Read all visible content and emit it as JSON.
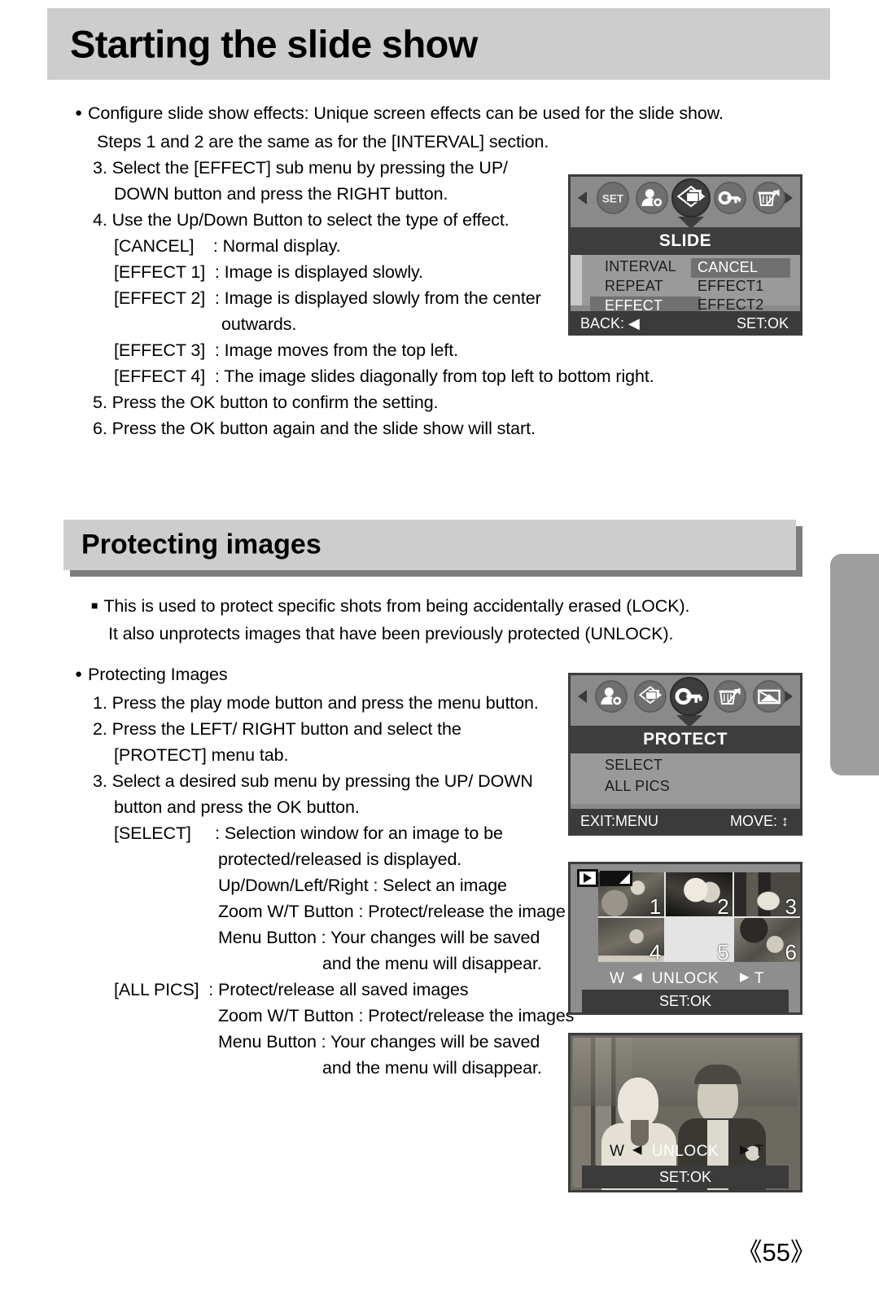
{
  "page": {
    "number": "《55》"
  },
  "section1": {
    "heading": "Starting the slide show",
    "lines": [
      "Configure slide show effects: Unique screen effects can be used for the slide show.",
      "Steps 1 and 2 are the same as for the [INTERVAL] section.",
      "3. Select the [EFFECT] sub menu by pressing the UP/",
      "DOWN button and press the RIGHT button.",
      "4. Use the Up/Down Button to select the type of effect.",
      "[CANCEL]    : Normal display.",
      "[EFFECT 1]  : Image is displayed slowly.",
      "[EFFECT 2]  : Image is displayed slowly from the center",
      "outwards.",
      "[EFFECT 3]  : Image moves from the top left.",
      "[EFFECT 4]  : The image slides diagonally from top left to bottom right.",
      "5. Press the OK button to confirm the setting.",
      "6. Press the OK button again and the slide show will start."
    ]
  },
  "section2": {
    "heading": "Protecting images",
    "intro": [
      "This is used to protect specific shots from being accidentally erased (LOCK).",
      "It also unprotects images that have been previously protected (UNLOCK)."
    ],
    "lines": [
      "Protecting Images",
      "1. Press the play mode button and press the menu button.",
      "2. Press the LEFT/ RIGHT button and select the",
      "[PROTECT] menu tab.",
      "3. Select a desired sub menu by pressing the UP/ DOWN",
      "button and press the OK button.",
      "[SELECT]     : Selection window for an image to be",
      "protected/released is displayed.",
      "Up/Down/Left/Right : Select an image",
      "Zoom W/T Button : Protect/release the image",
      "Menu Button : Your changes will be saved",
      "and the menu will disappear.",
      "[ALL PICS]  : Protect/release all saved images",
      "Zoom W/T Button : Protect/release the images",
      "Menu Button : Your changes will be saved",
      "and the menu will disappear."
    ]
  },
  "lcd_slide": {
    "title": "SLIDE",
    "icons": [
      {
        "name": "left-arrow",
        "label": "◀"
      },
      {
        "name": "set-icon",
        "label": "SET"
      },
      {
        "name": "user-image-icon",
        "label": ""
      },
      {
        "name": "slideshow-icon",
        "label": "",
        "selected": true
      },
      {
        "name": "key-protect-icon",
        "label": ""
      },
      {
        "name": "delete-trash-icon",
        "label": ""
      },
      {
        "name": "right-arrow",
        "label": "▶"
      }
    ],
    "menu_left": [
      {
        "label": "INTERVAL",
        "highlighted": false
      },
      {
        "label": "REPEAT",
        "highlighted": false
      },
      {
        "label": "EFFECT",
        "highlighted": true
      }
    ],
    "menu_right": [
      {
        "label": "CANCEL",
        "highlighted": true
      },
      {
        "label": "EFFECT1",
        "highlighted": false
      },
      {
        "label": "EFFECT2",
        "highlighted": false
      }
    ],
    "footer_left": "BACK: ◀",
    "footer_right": "SET:OK"
  },
  "lcd_protect": {
    "title": "PROTECT",
    "icons": [
      {
        "name": "left-arrow",
        "label": "◀"
      },
      {
        "name": "user-image-icon",
        "label": ""
      },
      {
        "name": "slideshow-icon",
        "label": ""
      },
      {
        "name": "key-protect-icon",
        "label": "",
        "selected": true
      },
      {
        "name": "delete-trash-icon",
        "label": ""
      },
      {
        "name": "dpof-print-icon",
        "label": ""
      },
      {
        "name": "right-arrow",
        "label": "▶"
      }
    ],
    "menu": [
      {
        "label": "SELECT"
      },
      {
        "label": "ALL PICS"
      }
    ],
    "footer_left": "EXIT:MENU",
    "footer_right": "MOVE: ↕"
  },
  "lcd_thumbnails": {
    "numbers": [
      "1",
      "2",
      "3",
      "4",
      "5",
      "6"
    ],
    "w_label": "W",
    "t_label": "T",
    "status": "UNLOCK",
    "setok": "SET:OK"
  },
  "lcd_single": {
    "w_label": "W",
    "t_label": "T",
    "status": "UNLOCK",
    "setok": "SET:OK"
  },
  "colors": {
    "header_bar": "#cdcdcd",
    "header_shadow": "#7c7c7c",
    "lcd_bg": "#9a9a9a",
    "lcd_dark": "#3d3d3d",
    "side_tab": "#9e9e9e"
  }
}
